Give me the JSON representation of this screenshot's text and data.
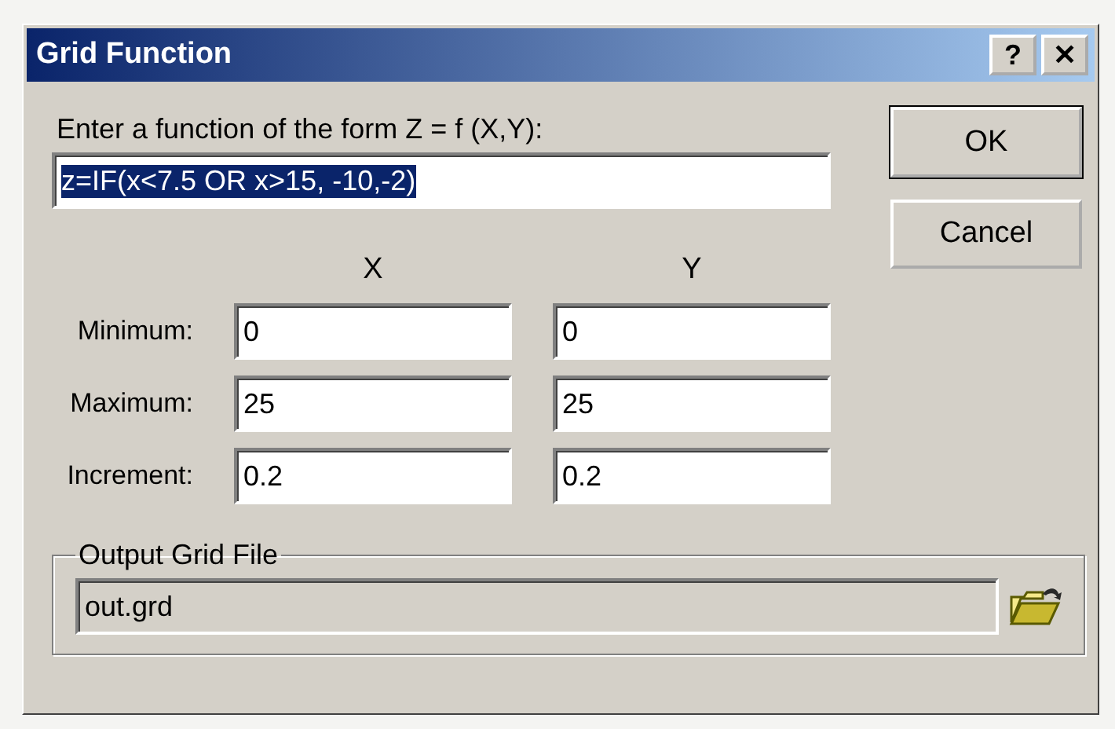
{
  "window": {
    "title": "Grid Function",
    "help_button": "?",
    "close_button": "✕"
  },
  "function": {
    "label": "Enter a function of the form Z = f (X,Y):",
    "value": "z=IF(x<7.5 OR x>15, -10,-2)",
    "selected": true
  },
  "buttons": [
    {
      "label": "OK",
      "default": true
    },
    {
      "label": "Cancel",
      "default": false
    }
  ],
  "columns": [
    "X",
    "Y"
  ],
  "rows": [
    {
      "label": "Minimum:",
      "values": [
        "0",
        "0"
      ]
    },
    {
      "label": "Maximum:",
      "values": [
        "25",
        "25"
      ]
    },
    {
      "label": "Increment:",
      "values": [
        "0.2",
        "0.2"
      ]
    }
  ],
  "output": {
    "legend": "Output Grid File",
    "value": "out.grd"
  }
}
